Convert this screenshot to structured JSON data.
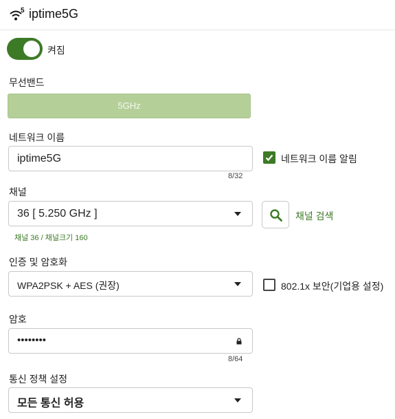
{
  "header": {
    "title": "iptime5G",
    "icon": "wifi-5g-icon"
  },
  "power": {
    "label": "켜짐",
    "state": "on"
  },
  "band": {
    "label": "무선밴드",
    "value": "5GHz"
  },
  "ssid": {
    "label": "네트워크 이름",
    "value": "iptime5G",
    "counter": "8/32",
    "broadcast_label": "네트워크 이름 알림",
    "broadcast_checked": true
  },
  "channel": {
    "label": "채널",
    "value": "36 [ 5.250 GHz ]",
    "scan_label": "채널 검색",
    "info": "채널 36 / 채널크기 160"
  },
  "auth": {
    "label": "인증 및 암호화",
    "value": "WPA2PSK + AES (권장)",
    "enterprise_label": "802.1x 보안(기업용 설정)",
    "enterprise_checked": false
  },
  "password": {
    "label": "암호",
    "value": "••••••••",
    "counter": "8/64"
  },
  "policy": {
    "label": "통신 정책 설정",
    "value": "모든 통신 허용"
  },
  "colors": {
    "accent": "#3d7a26",
    "band_button": "#b4cf98"
  }
}
